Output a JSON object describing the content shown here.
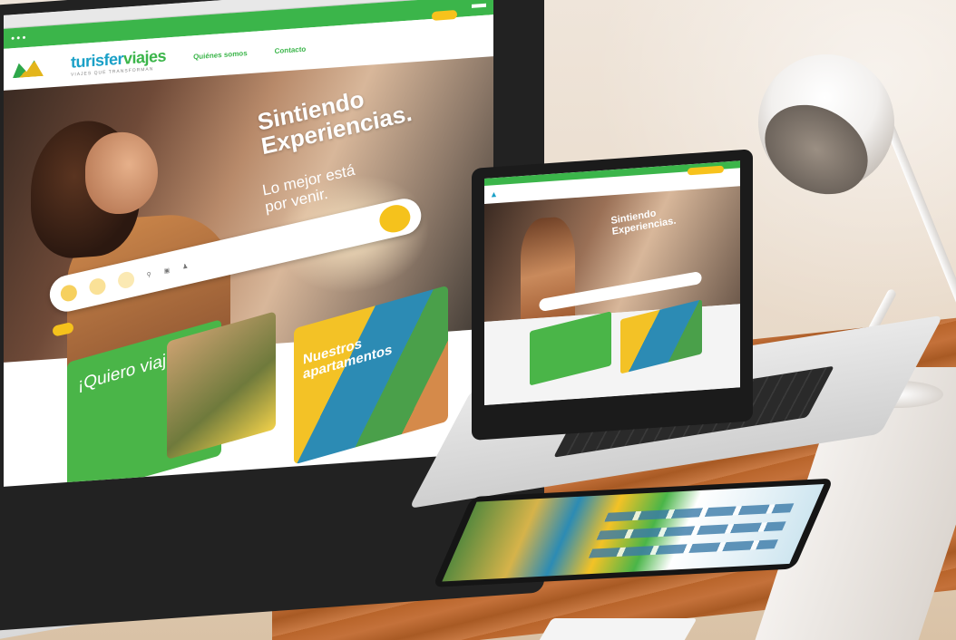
{
  "monitor_site": {
    "logo_text_a": "turisfer",
    "logo_text_b": "viajes",
    "logo_tagline": "VIAJES QUE TRANSFORMAN",
    "nav": [
      "Quiénes somos",
      "Contacto"
    ],
    "hero_title_line1": "Sintiendo",
    "hero_title_line2": "Experiencias.",
    "hero_sub_line1": "Lo mejor está",
    "hero_sub_line2": "por venir.",
    "card_green_title": "¡Quiero viajar!",
    "card_yellow_title": "Nuestros apartamentos"
  },
  "laptop_site": {
    "hero_title_line1": "Sintiendo",
    "hero_title_line2": "Experiencias."
  },
  "colors": {
    "brand_green": "#3bb54a",
    "brand_blue": "#1aa0c7",
    "brand_yellow": "#f7c21c"
  }
}
